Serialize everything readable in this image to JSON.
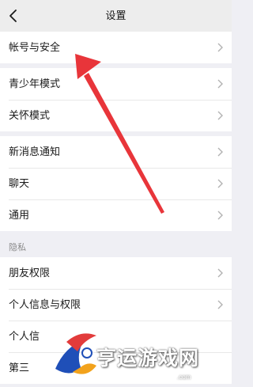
{
  "header": {
    "title": "设置",
    "back_icon": "chevron-left-icon"
  },
  "sections": [
    {
      "items": [
        {
          "label": "帐号与安全"
        }
      ]
    },
    {
      "items": [
        {
          "label": "青少年模式"
        },
        {
          "label": "关怀模式"
        }
      ]
    },
    {
      "items": [
        {
          "label": "新消息通知"
        },
        {
          "label": "聊天"
        },
        {
          "label": "通用"
        }
      ]
    }
  ],
  "privacy": {
    "group_label": "隐私",
    "items": [
      {
        "label": "朋友权限"
      },
      {
        "label": "个人信息与权限"
      },
      {
        "label": "个人信"
      },
      {
        "label": "第三"
      }
    ]
  },
  "annotation": {
    "type": "red-arrow",
    "color": "#e8353a"
  },
  "watermark": {
    "text": "亨运游戏网",
    "subtext": ".com"
  },
  "colors": {
    "background": "#efeff4",
    "header": "#ededed",
    "row": "#ffffff",
    "chevron": "#b2b2b2"
  }
}
